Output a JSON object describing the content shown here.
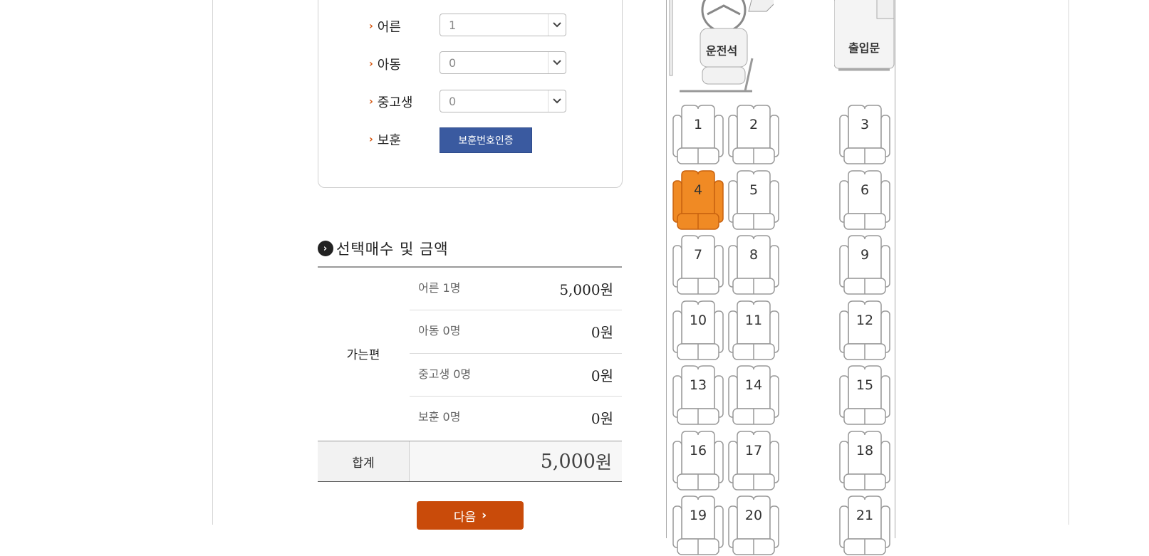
{
  "passengers": {
    "adult": {
      "label": "어른",
      "value": "1"
    },
    "child": {
      "label": "아동",
      "value": "0"
    },
    "student": {
      "label": "중고생",
      "value": "0"
    },
    "veteran": {
      "label": "보훈",
      "button": "보훈번호인증"
    }
  },
  "summary": {
    "title": "선택매수 및 금액",
    "trip": "가는편",
    "rows": [
      {
        "name": "어른 1명",
        "amount": "5,000",
        "unit": "원"
      },
      {
        "name": "아동 0명",
        "amount": "0",
        "unit": "원"
      },
      {
        "name": "중고생 0명",
        "amount": "0",
        "unit": "원"
      },
      {
        "name": "보훈 0명",
        "amount": "0",
        "unit": "원"
      }
    ],
    "total_label": "합계",
    "total_amount": "5,000",
    "total_unit": "원"
  },
  "next_button": "다음",
  "bus": {
    "driver_label": "운전석",
    "door_label": "출입문",
    "seats": [
      "1",
      "2",
      "3",
      "4",
      "5",
      "6",
      "7",
      "8",
      "9",
      "10",
      "11",
      "12",
      "13",
      "14",
      "15",
      "16",
      "17",
      "18",
      "19",
      "20",
      "21"
    ],
    "selected_seat": "4"
  },
  "colors": {
    "accent": "#c94b0a",
    "selected_seat": "#f08a24",
    "cert_button": "#3a5aa0"
  }
}
